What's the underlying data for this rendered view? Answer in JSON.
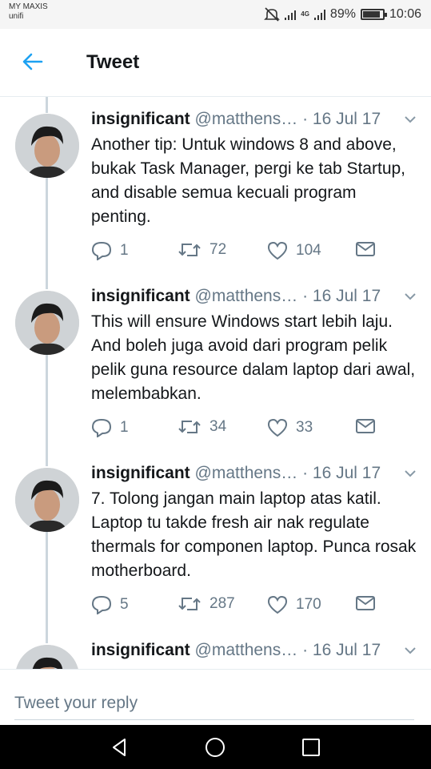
{
  "status_bar": {
    "carrier": "MY MAXIS",
    "carrier_sub": "unifi",
    "network": "4G",
    "battery": "89%",
    "battery_level": 0.89,
    "time": "10:06"
  },
  "header": {
    "title": "Tweet"
  },
  "tweets": [
    {
      "name": "insignificant",
      "handle": "@matthens…",
      "date": "· 16 Jul 17",
      "text": "Another tip: Untuk windows 8 and above, bukak Task Manager, pergi ke tab Startup, and disable semua kecuali program penting.",
      "replies": "1",
      "retweets": "72",
      "likes": "104"
    },
    {
      "name": "insignificant",
      "handle": "@matthens…",
      "date": "· 16 Jul 17",
      "text": "This will ensure Windows start lebih laju. And boleh juga avoid dari program pelik pelik guna resource dalam laptop dari awal, melembabkan.",
      "replies": "1",
      "retweets": "34",
      "likes": "33"
    },
    {
      "name": "insignificant",
      "handle": "@matthens…",
      "date": "· 16 Jul 17",
      "text": "7. Tolong jangan main laptop atas katil. Laptop tu takde fresh air nak regulate thermals for componen laptop. Punca rosak motherboard.",
      "replies": "5",
      "retweets": "287",
      "likes": "170"
    },
    {
      "name": "insignificant",
      "handle": "@matthens…",
      "date": "· 16 Jul 17"
    }
  ],
  "reply": {
    "placeholder": "Tweet your reply"
  },
  "icons": {
    "back": "arrow-left-icon",
    "reply": "speech-bubble-icon",
    "retweet": "retweet-icon",
    "like": "heart-icon",
    "dm": "envelope-icon",
    "caret": "chevron-down-icon"
  },
  "colors": {
    "accent": "#1da1f2",
    "muted": "#657786",
    "line": "#ccd6dd"
  }
}
